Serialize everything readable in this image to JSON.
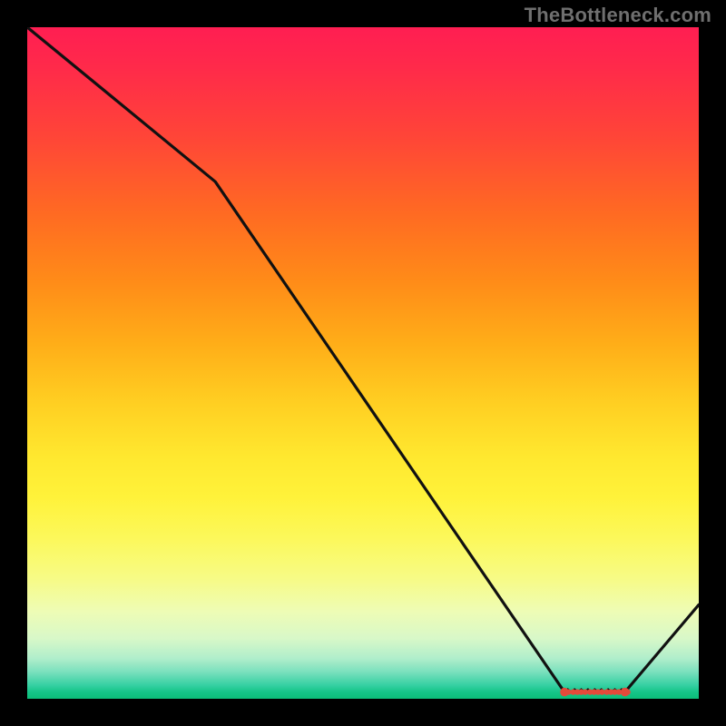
{
  "attribution": "TheBottleneck.com",
  "chart_data": {
    "type": "line",
    "title": "",
    "xlabel": "",
    "ylabel": "",
    "xlim": [
      0,
      100
    ],
    "ylim": [
      0,
      100
    ],
    "x": [
      0,
      28,
      80,
      89,
      100
    ],
    "values": [
      100,
      77,
      1,
      1,
      14
    ],
    "flat_region": {
      "x_start": 80,
      "x_end": 89,
      "y": 1
    },
    "markers": {
      "x": [
        80.0,
        80.6,
        81.3,
        81.9,
        82.5,
        83.1,
        83.8,
        84.4,
        85.0,
        85.6,
        86.3,
        86.9,
        87.5,
        88.1,
        88.8,
        89.4,
        89.0
      ],
      "y": 1,
      "color": "#e44a3a",
      "radius": 3.2
    },
    "gradient_stops": [
      {
        "pos": 0,
        "color": "#ff1e52"
      },
      {
        "pos": 50,
        "color": "#ffd01e"
      },
      {
        "pos": 80,
        "color": "#fdfa60"
      },
      {
        "pos": 100,
        "color": "#0cbd78"
      }
    ]
  }
}
